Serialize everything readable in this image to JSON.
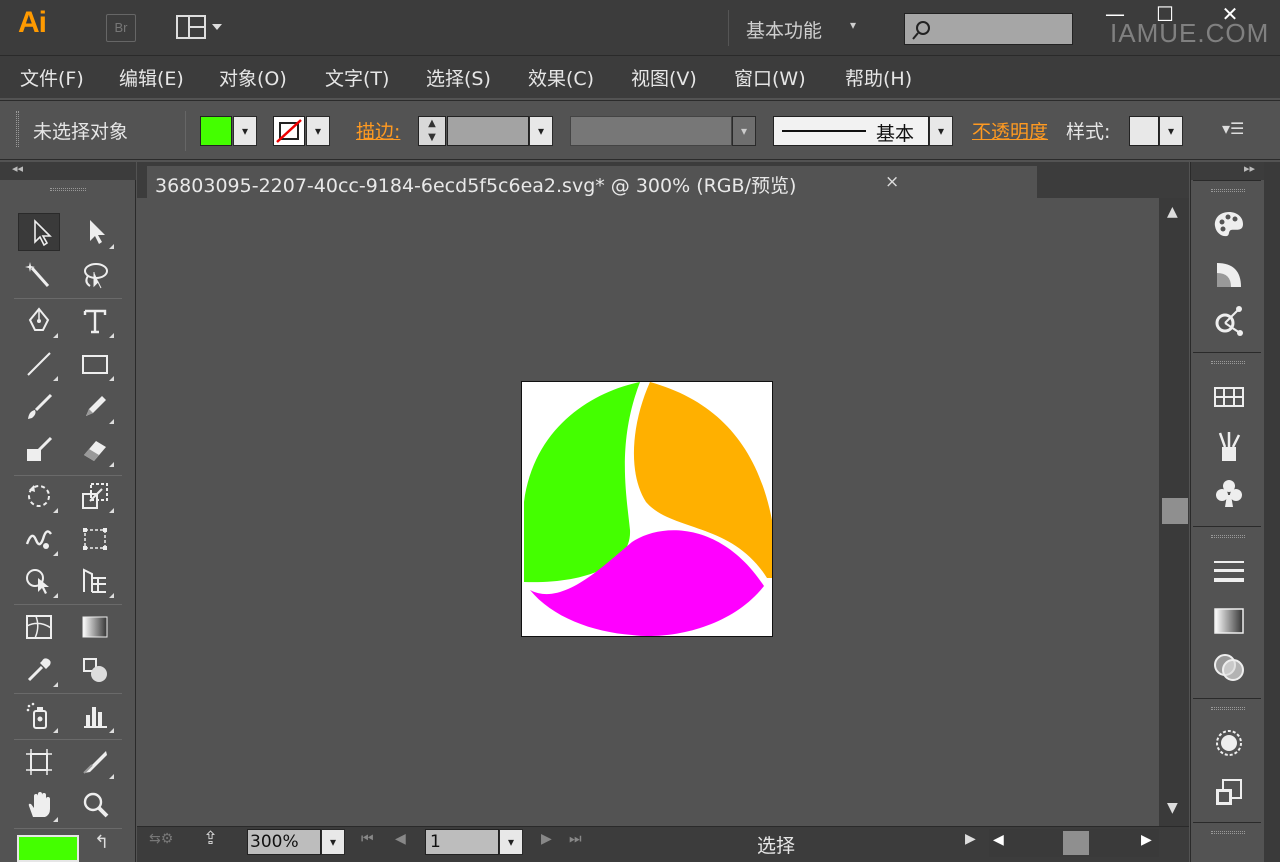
{
  "app": {
    "logo": "Ai",
    "bridge_label": "Br",
    "workspace": "基本功能",
    "search_placeholder": "",
    "watermark": "IAMUE.COM",
    "window_buttons": {
      "minimize": "—",
      "maximize": "☐",
      "close": "✕"
    }
  },
  "menu": [
    "文件(F)",
    "编辑(E)",
    "对象(O)",
    "文字(T)",
    "选择(S)",
    "效果(C)",
    "视图(V)",
    "窗口(W)",
    "帮助(H)"
  ],
  "control_bar": {
    "selection_status": "未选择对象",
    "fill_color": "#44ff00",
    "stroke_label": "描边:",
    "brush_label": "基本",
    "opacity_label": "不透明度",
    "style_label": "样式:"
  },
  "document": {
    "tab_title": "36803095-2207-40cc-9184-6ecd5f5c6ea2.svg*  @  300%  (RGB/预览)",
    "close_glyph": "×"
  },
  "artwork": {
    "petal_colors": {
      "green": "#44ff00",
      "orange": "#ffb000",
      "magenta": "#ff00ff"
    }
  },
  "status_bar": {
    "zoom": "300%",
    "page": "1",
    "tool_status": "选择"
  },
  "tools": [
    "selection-tool",
    "direct-selection-tool",
    "magic-wand-tool",
    "lasso-tool",
    "pen-tool",
    "type-tool",
    "line-tool",
    "rectangle-tool",
    "paintbrush-tool",
    "pencil-tool",
    "blob-brush-tool",
    "eraser-tool",
    "rotate-tool",
    "scale-tool",
    "warp-tool",
    "free-transform-tool",
    "shape-builder-tool",
    "perspective-grid-tool",
    "mesh-tool",
    "gradient-tool",
    "eyedropper-tool",
    "blend-tool",
    "symbol-sprayer-tool",
    "column-graph-tool",
    "artboard-tool",
    "slice-tool",
    "hand-tool",
    "zoom-tool"
  ]
}
